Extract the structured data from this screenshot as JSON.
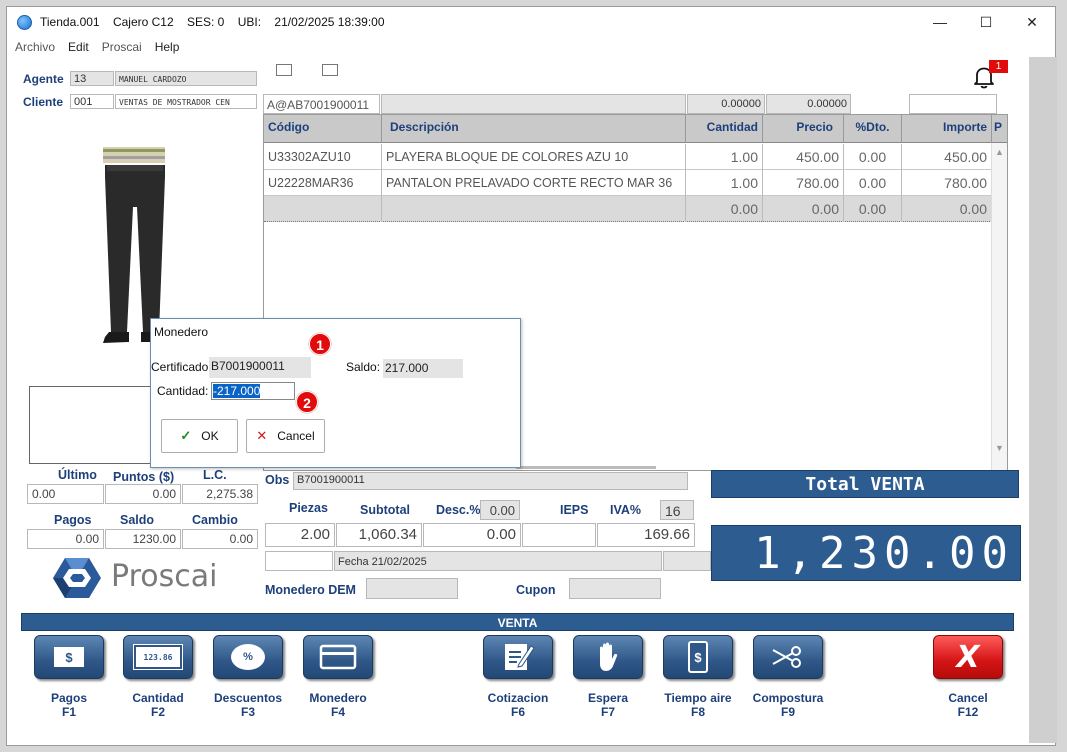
{
  "window": {
    "title_parts": [
      "Tienda.001",
      "Cajero C12",
      "SES: 0",
      "UBI:",
      "21/02/2025 18:39:00"
    ],
    "minimize": "—",
    "maximize": "☐",
    "close": "✕"
  },
  "menu": [
    "Archivo",
    "Edit",
    "Proscai",
    "Help"
  ],
  "header": {
    "agente_label": "Agente",
    "agente_code": "13",
    "agente_name": "MANUEL CARDOZO",
    "cliente_label": "Cliente",
    "cliente_code": "001",
    "cliente_name": "VENTAS DE MOSTRADOR CEN",
    "scan_code": "A@AB7001900011",
    "num1": "0.00000",
    "num2": "0.00000",
    "notif_count": "1"
  },
  "grid": {
    "columns": [
      "Código",
      "Descripción",
      "Cantidad",
      "Precio",
      "%Dto.",
      "Importe",
      "P"
    ],
    "rows": [
      {
        "codigo": "U33302AZU10",
        "descripcion": "PLAYERA BLOQUE DE COLORES AZU 10",
        "cantidad": "1.00",
        "precio": "450.00",
        "dto": "0.00",
        "importe": "450.00"
      },
      {
        "codigo": "U22228MAR36",
        "descripcion": "PANTALON PRELAVADO CORTE RECTO MAR 36",
        "cantidad": "1.00",
        "precio": "780.00",
        "dto": "0.00",
        "importe": "780.00"
      },
      {
        "codigo": "",
        "descripcion": "",
        "cantidad": "0.00",
        "precio": "0.00",
        "dto": "0.00",
        "importe": "0.00"
      }
    ]
  },
  "left_stats": {
    "ultimo_label": "Último",
    "puntos_label": "Puntos ($)",
    "lc_label": "L.C.",
    "ultimo": "0.00",
    "puntos": "0.00",
    "lc": "2,275.38",
    "pagos_label": "Pagos",
    "saldo_label": "Saldo",
    "cambio_label": "Cambio",
    "pagos": "0.00",
    "saldo": "1230.00",
    "cambio": "0.00"
  },
  "summary": {
    "obs_label": "Obs",
    "obs_value": "B7001900011",
    "piezas_label": "Piezas",
    "subtotal_label": "Subtotal",
    "desc_label": "Desc.%",
    "desc_pct": "0.00",
    "ieps_label": "IEPS",
    "iva_label": "IVA%",
    "iva_pct": "16",
    "piezas": "2.00",
    "subtotal": "1,060.34",
    "desc": "0.00",
    "iva": "169.66",
    "fecha": "Fecha 21/02/2025",
    "monedero_label": "Monedero DEM",
    "cupon_label": "Cupon"
  },
  "total": {
    "label": "Total VENTA",
    "value": "1,230.00"
  },
  "logo_text": "Proscai",
  "section_label": "VENTA",
  "fkeys": [
    {
      "label": "Pagos",
      "key": "F1",
      "icon": "$"
    },
    {
      "label": "Cantidad",
      "key": "F2",
      "icon": "123.86"
    },
    {
      "label": "Descuentos",
      "key": "F3",
      "icon": "%"
    },
    {
      "label": "Monedero",
      "key": "F4",
      "icon": "card"
    },
    {
      "label": "Cotizacion",
      "key": "F6",
      "icon": "edit"
    },
    {
      "label": "Espera",
      "key": "F7",
      "icon": "hand"
    },
    {
      "label": "Tiempo aire",
      "key": "F8",
      "icon": "$"
    },
    {
      "label": "Compostura",
      "key": "F9",
      "icon": "scissors"
    },
    {
      "label": "Cancel",
      "key": "F12",
      "icon": "X"
    }
  ],
  "dialog": {
    "title": "Monedero",
    "certificado_label": "Certificado",
    "certificado": "B7001900011",
    "saldo_label": "Saldo:",
    "saldo": "217.000",
    "cantidad_label": "Cantidad:",
    "cantidad": "-217.000",
    "ok_label": "OK",
    "cancel_label": "Cancel",
    "step1": "1",
    "step2": "2"
  },
  "colors": {
    "accent_blue": "#2d5c90",
    "label_blue": "#1d3f7a",
    "cancel_red": "#d41414",
    "badge_red": "#e20b0b"
  }
}
